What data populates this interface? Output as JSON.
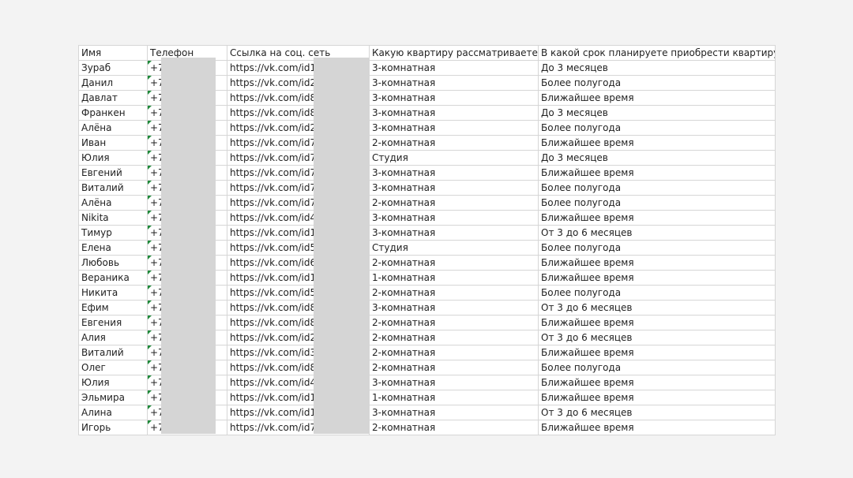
{
  "headers": [
    "Имя",
    "Телефон",
    "Ссылка на соц. сеть",
    "Какую квартиру рассматриваете?",
    "В какой срок планируете приобрести квартиру?"
  ],
  "rows": [
    [
      "Зураб",
      "+7",
      "https://vk.com/id1",
      "3-комнатная",
      "До 3 месяцев"
    ],
    [
      "Данил",
      "+7",
      "https://vk.com/id2",
      "3-комнатная",
      "Более полугода"
    ],
    [
      "Давлат",
      "+7",
      "https://vk.com/id8",
      "3-комнатная",
      "Ближайшее время"
    ],
    [
      "Франкен",
      "+7",
      "https://vk.com/id8",
      "3-комнатная",
      "До 3 месяцев"
    ],
    [
      "Алёна",
      "+7",
      "https://vk.com/id2",
      "3-комнатная",
      "Более полугода"
    ],
    [
      "Иван",
      "+7",
      "https://vk.com/id7",
      "2-комнатная",
      "Ближайшее время"
    ],
    [
      "Юлия",
      "+7",
      "https://vk.com/id7",
      "Студия",
      "До 3 месяцев"
    ],
    [
      "Евгений",
      "+7",
      "https://vk.com/id7",
      "3-комнатная",
      "Ближайшее время"
    ],
    [
      "Виталий",
      "+7",
      "https://vk.com/id7",
      "3-комнатная",
      "Более полугода"
    ],
    [
      "Алёна",
      "+7",
      "https://vk.com/id7",
      "2-комнатная",
      "Более полугода"
    ],
    [
      "Nikita",
      "+7",
      "https://vk.com/id4",
      "3-комнатная",
      "Ближайшее время"
    ],
    [
      "Тимур",
      "+7",
      "https://vk.com/id1",
      "3-комнатная",
      "От 3 до 6 месяцев"
    ],
    [
      "Елена",
      "+7",
      "https://vk.com/id5",
      "Студия",
      "Более полугода"
    ],
    [
      "Любовь",
      "+7",
      "https://vk.com/id6",
      "2-комнатная",
      "Ближайшее время"
    ],
    [
      "Вераника",
      "+7",
      "https://vk.com/id1",
      "1-комнатная",
      "Ближайшее время"
    ],
    [
      "Никита",
      "+7",
      "https://vk.com/id5",
      "2-комнатная",
      "Более полугода"
    ],
    [
      "Ефим",
      "+7",
      "https://vk.com/id8",
      "3-комнатная",
      "От 3 до 6 месяцев"
    ],
    [
      "Евгения",
      "+7",
      "https://vk.com/id8",
      "2-комнатная",
      "Ближайшее время"
    ],
    [
      "Алия",
      "+7",
      "https://vk.com/id2",
      "2-комнатная",
      "От 3 до 6 месяцев"
    ],
    [
      "Виталий",
      "+7",
      "https://vk.com/id3",
      "2-комнатная",
      "Ближайшее время"
    ],
    [
      "Олег",
      "+7",
      "https://vk.com/id8",
      "2-комнатная",
      "Более полугода"
    ],
    [
      "Юлия",
      "+7",
      "https://vk.com/id4",
      "3-комнатная",
      "Ближайшее время"
    ],
    [
      "Эльмира",
      "+7",
      "https://vk.com/id1",
      "1-комнатная",
      "Ближайшее время"
    ],
    [
      "Алина",
      "+7",
      "https://vk.com/id1",
      "3-комнатная",
      "От 3 до 6 месяцев"
    ],
    [
      "Игорь",
      "+7",
      "https://vk.com/id7",
      "2-комнатная",
      "Ближайшее время"
    ]
  ],
  "colors": {
    "grid": "#d6d6d6",
    "mask": "#d5d5d5",
    "number_marker": "#1f8a3a"
  }
}
